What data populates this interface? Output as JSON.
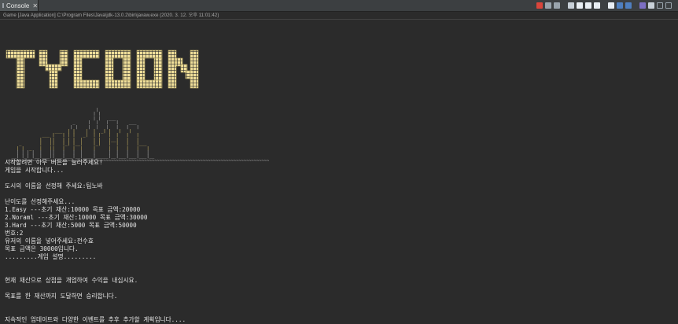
{
  "tab": {
    "label": "Console",
    "close": "✕"
  },
  "toolbar": {
    "icons": [
      "stop-icon",
      "remove-launch-icon",
      "remove-all-icon",
      "clear-console-icon",
      "scroll-lock-icon",
      "word-wrap-icon",
      "show-when-stdout-icon",
      "show-when-stderr-icon",
      "pin-console-icon",
      "display-selected-console-icon",
      "open-console-icon",
      "new-console-view-icon",
      "minimize-icon",
      "maximize-icon"
    ]
  },
  "path": "Game [Java Application] C:\\Program Files\\Java\\jdk-13.0.2\\bin\\javaw.exe (2020. 3. 12. 오후 11:01:42)",
  "banner": {
    "title": "TYCOON"
  },
  "ascii_art": {
    "lines": [
      "                                   |",
      "                                  | |",
      "                                  | |   ___",
      "                          _     |  |   |   |    ___",
      "                         | |    |  |   |   |   |   |",
      "                   ___  | |    |  |  _| |   |   |",
      "              ___ |   | | |   _|  | |   |  |   |   |",
      "             |   ||   | | |  |    | |   |__|   |   |",
      "     _       |   ||   |_| |__|    |_|   |  |   |   |___",
      "    | |  _   |   ||   |   |  |    |     |  |   |   |   |",
      "    | | | |  |   ||   |   |  |    |     |  |   |   |   |",
      "  __| |_| |__|___||___|___|__|____|_____|__|___|___|___|__",
      "~~~~~~~~~~~~~~~~~~~~~~~~~~~~~~~~~~~~~~~~~~~~~~~~~~~~~~~~~~~~~~~~~~~~~~~~~~~~~~~~~~~~~~~~~~~~~~~~~~~~~~~"
    ]
  },
  "console_lines": [
    "시작할려면 아무 버튼을 눌러주세요!",
    "게임을 시작합니다...",
    "",
    "도시의 이름을 선정해 주세요:팀노바",
    "",
    "난이도를 선정해주세요...",
    "1.Easy ---초기 재산:10000 목표 금액:20000",
    "2.Noraml ---초기 재산:10000 목표 금액:30000",
    "3.Hard ---초기 재산:5000 목표 금액:50000",
    "번호:2",
    "유저의 이름을 넣어주세요:전수효",
    "목표 금액은 30000입니다.",
    ".........게임 설명.........",
    "",
    "",
    "현재 재산으로 상점을 개업하여 수익을 내십시요.",
    "",
    "목표를 한 재산까지 도달하면 승리합니다.",
    "",
    "",
    "지속적인 업데이트와 다양한 이벤트를 추후 추가할 계획입니다...."
  ],
  "colors": {
    "background": "#2b2b2b",
    "text": "#e4e4e4",
    "banner": "#f0df9a",
    "banner_shadow": "#b8a964"
  }
}
